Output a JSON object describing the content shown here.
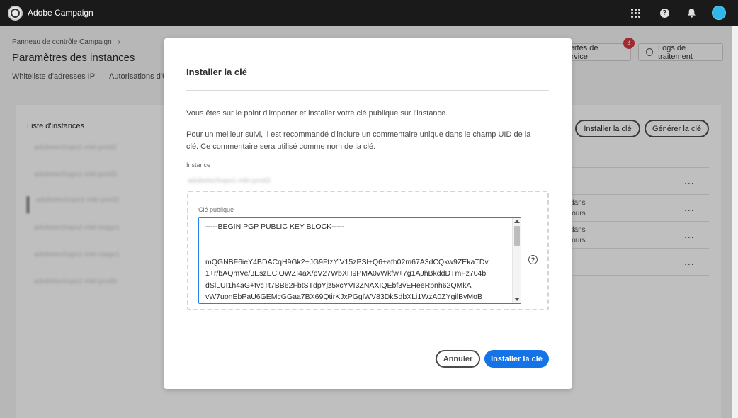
{
  "app": {
    "title": "Adobe Campaign"
  },
  "topbar": {
    "icons": [
      "apps-grid-icon",
      "help-icon",
      "notifications-bell-icon",
      "user-avatar"
    ],
    "accent_color": "#2fb8e9"
  },
  "page": {
    "breadcrumb": "Panneau de contrôle Campaign",
    "breadcrumb_separator": ">",
    "title": "Paramètres des instances",
    "tabs": [
      "Whiteliste d'adresses IP",
      "Autorisations d'URL"
    ],
    "alerts_label": "Alertes de service",
    "alerts_count": "4",
    "logs_label": "Logs de traitement",
    "list_title": "Liste d'instances",
    "instances": [
      "adobetechops1-mkt-prod2",
      "adobetechops1-mkt-prod3",
      "adobetechops1-mkt-prod3",
      "adobetechops2-mkt-stage1",
      "adobetechops1-mkt-stage1",
      "adobetechops1-mkt-prod9"
    ],
    "install_key_button": "Installer la clé",
    "generate_key_button": "Générer la clé",
    "row_snippets": [
      "dans",
      "jours",
      "dans",
      "jours"
    ],
    "more_icon": "..."
  },
  "modal": {
    "title": "Installer la clé",
    "intro": "Vous êtes sur le point d'importer et installer votre clé publique sur l'instance.",
    "advice": "Pour un meilleur suivi, il est recommandé d'inclure un commentaire unique dans le champ UID de la clé. Ce commentaire sera utilisé comme nom de la clé.",
    "instance_label": "Instance",
    "instance_value": "adobetechops1-mkt-prod3",
    "public_key_label": "Clé publique",
    "public_key_lines": [
      "-----BEGIN PGP PUBLIC KEY BLOCK-----",
      "",
      "",
      "mQGNBF6ieY4BDACqH9Gk2+JG9FtzYiV15zPSl+Q6+afb02m67A3dCQkw9ZEkaTDv",
      "1+r/bAQmVe/3EszEClOWZI4aX/pV27WbXH9PMA0vWkfw+7g1AJhBkddDTmFz704b",
      "dSlLUI1h4aG+tvcTt7BB62FbtSTdpYjz5xcYVI3ZNAXIQEbf3vEHeeRpnh62QMkA",
      "vW7uonEbPaU6GEMcGGaa7BX69QtirKJxPGglWV83DkSdbXLi1WzA0ZYgilByMoB"
    ],
    "cancel_label": "Annuler",
    "install_label": "Installer la clé",
    "primary_color": "#1473e6"
  }
}
